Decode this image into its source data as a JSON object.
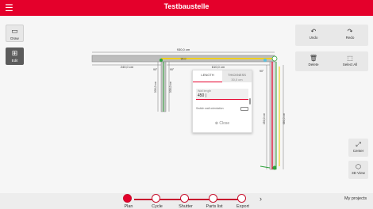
{
  "header": {
    "title": "Testbaustelle",
    "back_icon": "back-arrow-icon"
  },
  "tools": [
    {
      "icon": "draw-wall-icon",
      "label": "Draw"
    },
    {
      "icon": "edit-icon",
      "label": "Edit"
    }
  ],
  "panel_top": [
    {
      "icon": "undo-icon",
      "label": "Undo"
    },
    {
      "icon": "redo-icon",
      "label": "Redo"
    }
  ],
  "panel_bottom": [
    {
      "icon": "trash-icon",
      "label": "Delete"
    },
    {
      "icon": "select-all-icon",
      "label": "Select All"
    }
  ],
  "side": [
    {
      "icon": "center-icon",
      "label": "Center"
    },
    {
      "icon": "cube-icon",
      "label": "3D View"
    }
  ],
  "plan": {
    "dim_top_total": "930,0 cm",
    "dim_top_inner": "90,0",
    "dim_left_seg": "240,0 cm",
    "dim_right_seg": "610,0 cm",
    "dim_vertical_left_a": "330,0 cm",
    "dim_vertical_left_b": "330,0 cm",
    "dim_vertical_right_a": "450,0 cm",
    "dim_vertical_right_b": "680,0 cm",
    "angle_a": "90°",
    "angle_b": "90°",
    "angle_c": "90°"
  },
  "dialog": {
    "tab_length": "LENGTH",
    "tab_thickness": "THICKNESS",
    "tab_thickness_sub": "30,0 cm",
    "field_label": "Wall length",
    "field_value": "450 |",
    "switch_label": "Switch wall orientation",
    "close_label": "Close"
  },
  "steps": [
    "Plan",
    "Cycle",
    "Shutter",
    "Parts list",
    "Export"
  ],
  "bottom": {
    "my_projects": "My projects",
    "next_icon": "chevron-right-icon"
  },
  "colors": {
    "brand": "#e4002b",
    "wall_yellow": "#f0d020",
    "wall_green": "#2fa33c",
    "wall_gray": "#b5b5b5"
  }
}
